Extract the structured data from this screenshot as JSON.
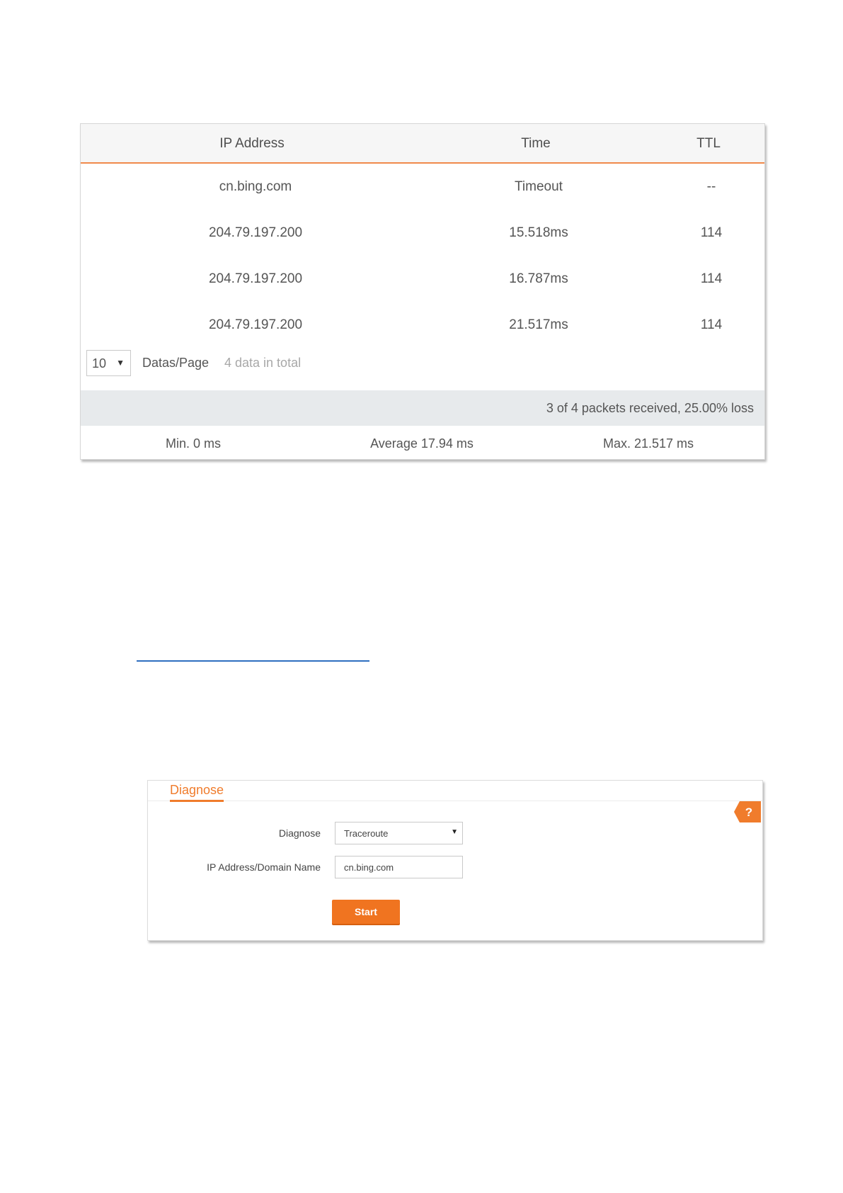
{
  "ping_result": {
    "columns": {
      "ip": "IP Address",
      "time": "Time",
      "ttl": "TTL"
    },
    "rows": [
      {
        "ip": "cn.bing.com",
        "time": "Timeout",
        "ttl": "--"
      },
      {
        "ip": "204.79.197.200",
        "time": "15.518ms",
        "ttl": "114"
      },
      {
        "ip": "204.79.197.200",
        "time": "16.787ms",
        "ttl": "114"
      },
      {
        "ip": "204.79.197.200",
        "time": "21.517ms",
        "ttl": "114"
      }
    ],
    "pager": {
      "page_size": "10",
      "page_size_label": "Datas/Page",
      "total_text": "4 data in total"
    },
    "summary": "3 of 4 packets received, 25.00% loss",
    "stats": {
      "min": "Min. 0 ms",
      "avg": "Average 17.94 ms",
      "max": "Max. 21.517 ms"
    }
  },
  "diagnose_panel": {
    "title": "Diagnose",
    "help_icon": "question-icon",
    "help_label": "?",
    "fields": {
      "diagnose_label": "Diagnose",
      "diagnose_value": "Traceroute",
      "address_label": "IP Address/Domain Name",
      "address_value": "cn.bing.com"
    },
    "start_label": "Start"
  },
  "colors": {
    "accent": "#f07c2c",
    "header_rule": "#f08a4b",
    "summary_bg": "#e7eaec",
    "link_rule": "#2e6fc0"
  }
}
